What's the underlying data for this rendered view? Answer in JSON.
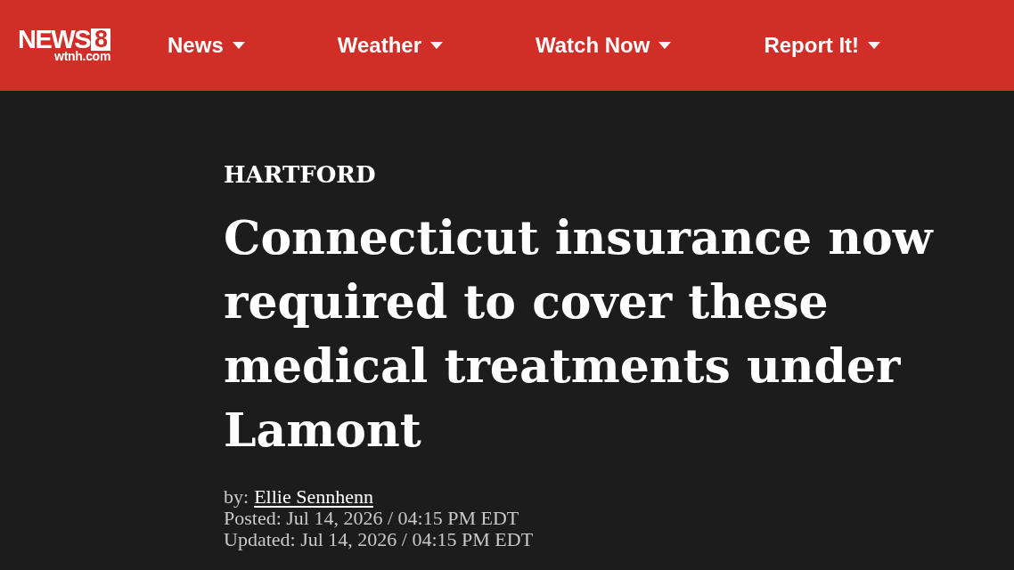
{
  "header": {
    "logo": {
      "wordmark": "NEWS",
      "number": "8",
      "domain": "wtnh.com"
    },
    "nav": [
      {
        "label": "News"
      },
      {
        "label": "Weather"
      },
      {
        "label": "Watch Now"
      },
      {
        "label": "Report It!"
      }
    ]
  },
  "article": {
    "section": "HARTFORD",
    "headline": "Connecticut insurance now required to cover these medical treatments under Lamont",
    "byline": {
      "prefix": "by:",
      "author": "Ellie Sennhenn"
    },
    "posted": "Posted: Jul 14, 2026 / 04:15 PM EDT",
    "updated": "Updated: Jul 14, 2026 / 04:15 PM EDT"
  }
}
